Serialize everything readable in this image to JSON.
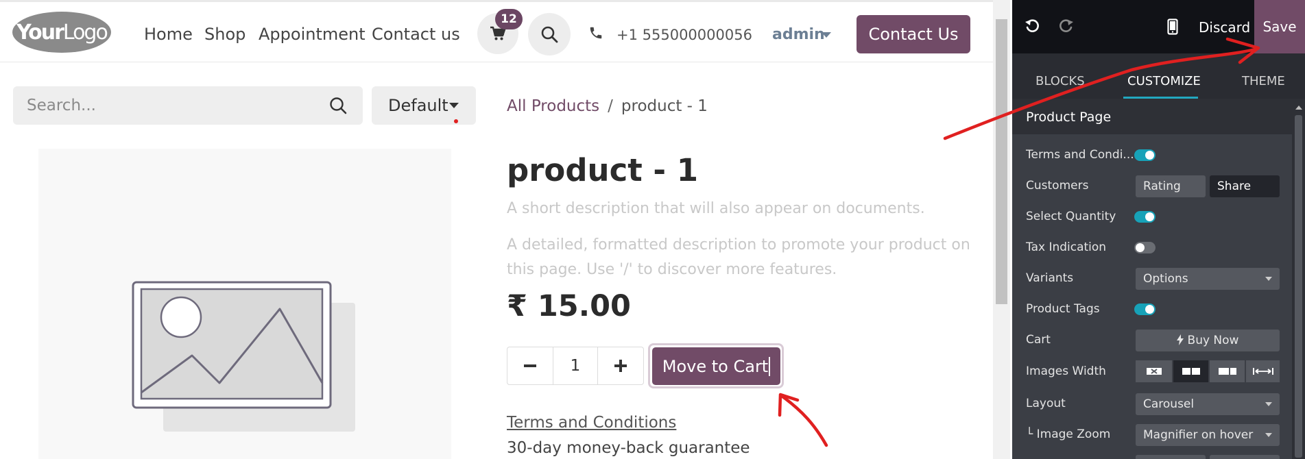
{
  "header": {
    "logo": {
      "bold": "Your",
      "light": "Logo"
    },
    "nav": [
      "Home",
      "Shop",
      "Appointment",
      "Contact us"
    ],
    "cart_count": "12",
    "phone": "+1 555000000056",
    "user": "admin",
    "cta": "Contact Us"
  },
  "shop": {
    "search_placeholder": "Search...",
    "sort_label": "Default",
    "breadcrumb": {
      "parent": "All Products",
      "separator": "/",
      "current": "product - 1"
    }
  },
  "product": {
    "title": "product - 1",
    "short_desc": "A short description that will also appear on documents.",
    "long_desc": "A detailed, formatted description to promote your product on this page. Use '/' to discover more features.",
    "price": "₹ 15.00",
    "quantity": "1",
    "cart_button": "Move to Cart",
    "terms": "Terms and Conditions",
    "guarantee": "30-day money-back guarantee"
  },
  "editor": {
    "discard": "Discard",
    "save": "Save",
    "tabs": [
      "BLOCKS",
      "CUSTOMIZE",
      "THEME"
    ],
    "active_tab": "CUSTOMIZE",
    "section": "Product Page",
    "options": {
      "terms": {
        "label": "Terms and Condi...",
        "on": true
      },
      "customers": {
        "label": "Customers",
        "a": "Rating",
        "b": "Share"
      },
      "quantity": {
        "label": "Select Quantity",
        "on": true
      },
      "tax": {
        "label": "Tax Indication",
        "on": false
      },
      "variants": {
        "label": "Variants",
        "value": "Options"
      },
      "tags": {
        "label": "Product Tags",
        "on": true
      },
      "cart": {
        "label": "Cart",
        "value": "Buy Now"
      },
      "images_width": {
        "label": "Images Width"
      },
      "layout": {
        "label": "Layout",
        "value": "Carousel"
      },
      "image_zoom": {
        "label": "└ Image Zoom",
        "value": "Magnifier on hover"
      }
    }
  },
  "colors": {
    "brand": "#714b67",
    "toggle_on": "#17a2b8",
    "annotation": "#e02020"
  }
}
